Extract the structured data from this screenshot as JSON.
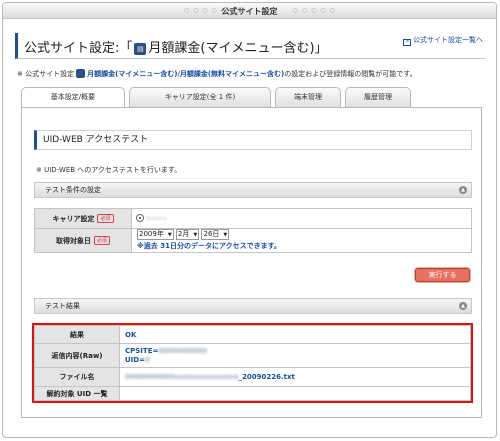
{
  "window": {
    "title": "公式サイト設定"
  },
  "header": {
    "title_prefix": "公式サイト設定:「",
    "title_name": "月額課金(マイメニュー含む)",
    "title_suffix": "」",
    "list_link": "公式サイト設定一覧へ"
  },
  "description": {
    "prefix": "※ 公式サイト設定",
    "link1": "月額課金(マイメニュー含む)",
    "link2": "月額課金(無料マイメニュー含む)",
    "suffix": "の設定および登録情報の閲覧が可能です。"
  },
  "tabs": [
    {
      "label": "基本設定/概要",
      "active": true
    },
    {
      "label": "キャリア設定(全 1 件)",
      "active": false
    },
    {
      "label": "端末管理",
      "active": false
    },
    {
      "label": "履歴管理",
      "active": false
    }
  ],
  "section": {
    "title": "UID-WEB アクセステスト",
    "note": "※ UID-WEB へのアクセステストを行います。"
  },
  "conditions": {
    "header": "テスト条件の設定",
    "carrier_label": "キャリア設定",
    "required_label": "必須",
    "carrier_value": "•••••",
    "date_label": "取得対象日",
    "year": "2009年",
    "month": "2月",
    "day": "26日",
    "hint": "※過去 31日分のデータにアクセスできます。"
  },
  "run_button": "実行する",
  "results": {
    "header": "テスト結果",
    "rows": [
      {
        "label": "結果",
        "value": "OK"
      },
      {
        "label": "返信内容(Raw)",
        "value": "CPSITE=",
        "value_blur": "0000000000",
        "value2": "UID=",
        "value2_blur": "0"
      },
      {
        "label": "ファイル名",
        "value_blur": "0000000000nnnnnnnnnnnnn",
        "value": "_20090226.txt"
      },
      {
        "label": "解約対象 UID 一覧",
        "value": ""
      }
    ]
  },
  "colors": {
    "accent": "#1f4f8f",
    "link": "#1a4fa0",
    "highlight_border": "#e01010",
    "run_button": "#e87060"
  }
}
